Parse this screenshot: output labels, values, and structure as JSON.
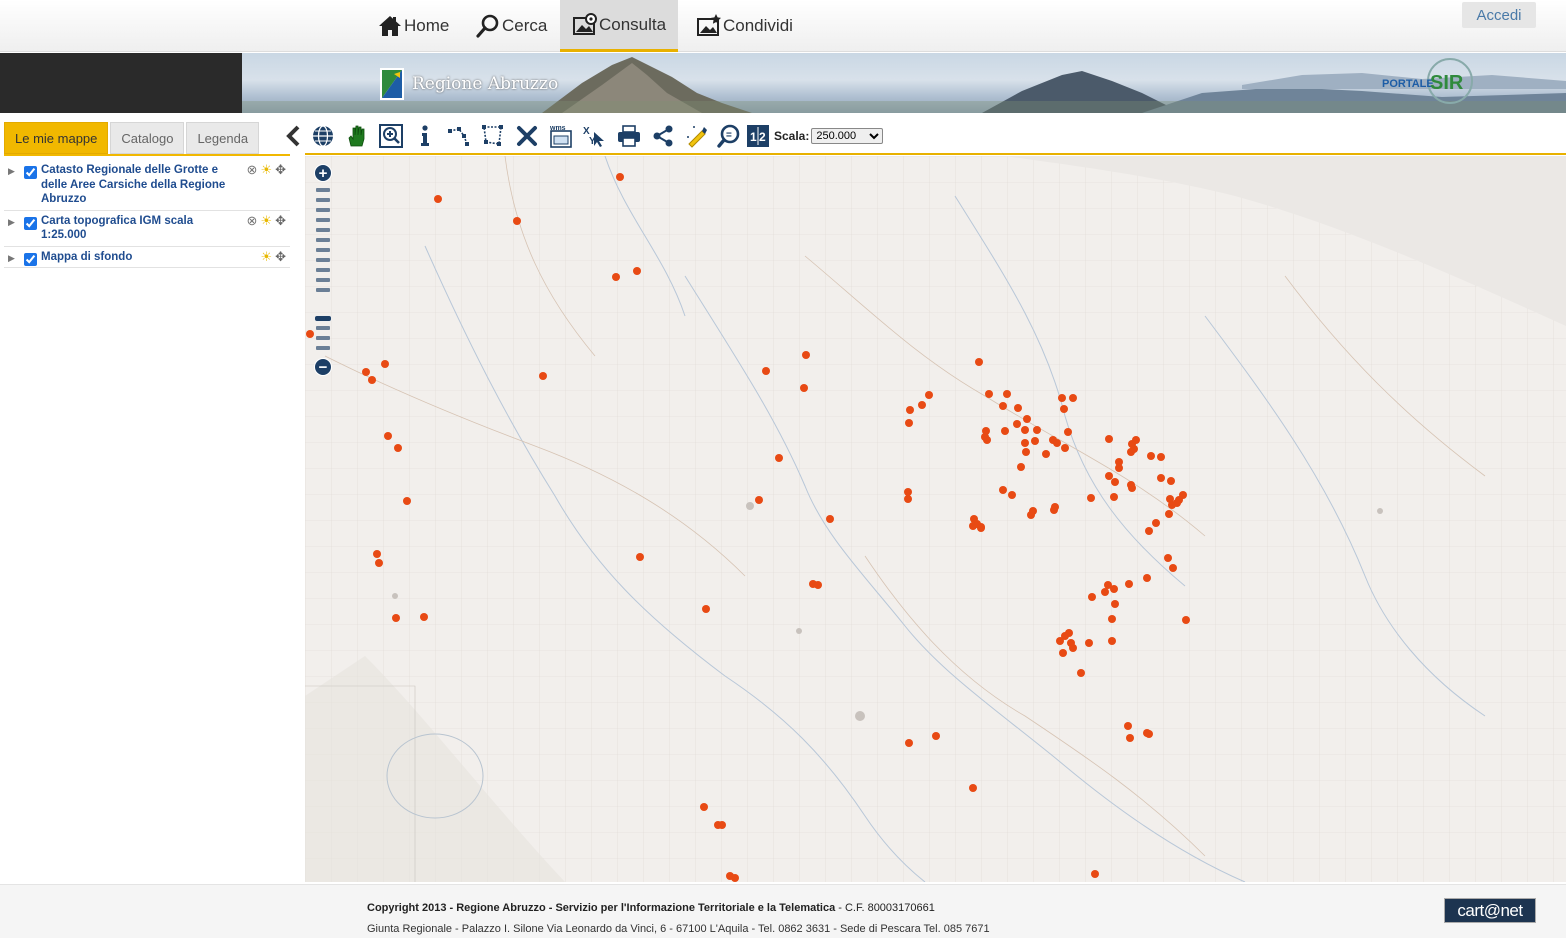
{
  "nav": {
    "items": [
      {
        "label": "Home",
        "icon": "home-icon"
      },
      {
        "label": "Cerca",
        "icon": "search-icon"
      },
      {
        "label": "Consulta",
        "icon": "map-view-icon",
        "active": true
      },
      {
        "label": "Condividi",
        "icon": "share-map-icon"
      }
    ],
    "login_label": "Accedi"
  },
  "banner": {
    "region_name": "Regione Abruzzo",
    "portal_logo_text": "PORTALE SIR"
  },
  "sidebar": {
    "tabs": [
      {
        "label": "Le mie mappe",
        "active": true
      },
      {
        "label": "Catalogo"
      },
      {
        "label": "Legenda"
      }
    ],
    "layers": [
      {
        "name": "Catasto Regionale delle Grotte e delle Aree Carsiche della Regione Abruzzo",
        "checked": true,
        "removable": true
      },
      {
        "name": "Carta topografica IGM scala 1:25.000",
        "checked": true,
        "removable": true
      },
      {
        "name": "Mappa di sfondo",
        "checked": true,
        "removable": false
      }
    ]
  },
  "toolbar": {
    "tools": [
      "collapse-panel-icon",
      "globe-icon",
      "pan-hand-icon",
      "zoom-box-icon",
      "info-icon",
      "measure-line-icon",
      "measure-area-icon",
      "clear-icon",
      "wms-icon",
      "coordinates-icon",
      "print-icon",
      "share-icon",
      "draw-icon",
      "zoom-scale-icon",
      "scale-1-2-icon"
    ],
    "scale_label": "Scala:",
    "scale_value": "250.000",
    "scale_options": [
      "250.000"
    ]
  },
  "colors": {
    "accent": "#f1b800",
    "point": "#e84a14",
    "layer_link": "#1f4c8f"
  },
  "footer": {
    "line1_bold": "Copyright 2013 - Regione Abruzzo - Servizio per l'Informazione Territoriale e la Telematica",
    "line1_rest": " - C.F. 80003170661",
    "line2": "Giunta Regionale - Palazzo I. Silone Via Leonardo da Vinci, 6 - 67100 L'Aquila - Tel. 0862 3631 - Sede di Pescara Tel. 085 7671",
    "brand": "cart@net"
  }
}
